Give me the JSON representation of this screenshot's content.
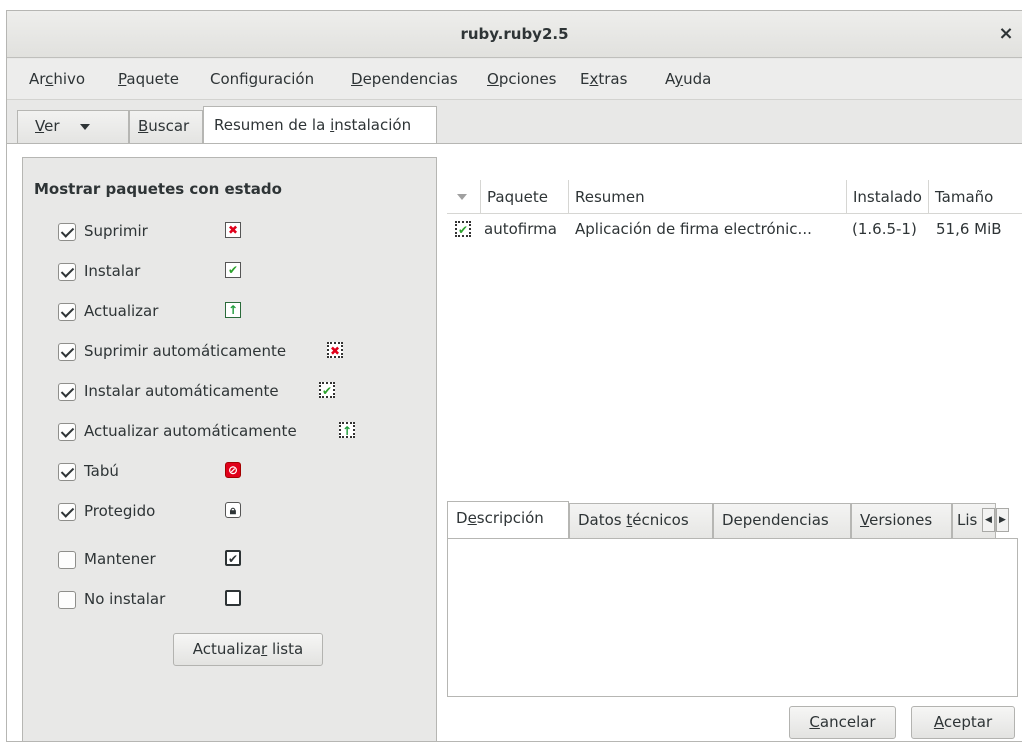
{
  "window": {
    "title": "ruby.ruby2.5",
    "close_glyph": "×"
  },
  "menubar": {
    "items": [
      {
        "pre": "Ar",
        "u": "c",
        "post": "hivo"
      },
      {
        "pre": "",
        "u": "P",
        "post": "aquete"
      },
      {
        "pre": "Confi",
        "u": "g",
        "post": "uración"
      },
      {
        "pre": "",
        "u": "D",
        "post": "ependencias"
      },
      {
        "pre": "",
        "u": "O",
        "post": "pciones"
      },
      {
        "pre": "E",
        "u": "x",
        "post": "tras"
      },
      {
        "pre": "A",
        "u": "y",
        "post": "uda"
      }
    ]
  },
  "toptabs": {
    "view": {
      "u": "V",
      "post": "er"
    },
    "search": {
      "u": "B",
      "post": "uscar"
    },
    "summary": {
      "pre": "Resumen de la ",
      "u": "i",
      "post": "nstalación"
    }
  },
  "filter": {
    "heading": "Mostrar paquetes con estado",
    "rows": [
      {
        "label": "Suprimir",
        "checked": true,
        "icon": "delete-status-icon"
      },
      {
        "label": "Instalar",
        "checked": true,
        "icon": "install-status-icon"
      },
      {
        "label": "Actualizar",
        "checked": true,
        "icon": "update-status-icon"
      },
      {
        "label": "Suprimir automáticamente",
        "checked": true,
        "icon": "autodelete-status-icon"
      },
      {
        "label": "Instalar automáticamente",
        "checked": true,
        "icon": "autoinstall-status-icon"
      },
      {
        "label": "Actualizar automáticamente",
        "checked": true,
        "icon": "autoupdate-status-icon"
      },
      {
        "label": "Tabú",
        "checked": true,
        "icon": "taboo-status-icon"
      },
      {
        "label": "Protegido",
        "checked": true,
        "icon": "lock-status-icon"
      },
      {
        "label": "Mantener",
        "checked": false,
        "icon": "keep-status-icon"
      },
      {
        "label": "No instalar",
        "checked": false,
        "icon": "noinstall-status-icon"
      }
    ],
    "refresh": {
      "pre": "Actualiza",
      "u": "r",
      "post": " lista"
    }
  },
  "table": {
    "columns": [
      "Paquete",
      "Resumen",
      "Instalado",
      "Tamaño"
    ],
    "rows": [
      {
        "package": "autofirma",
        "summary": "Aplicación de firma electrónic...",
        "installed": "(1.6.5-1)",
        "size": "51,6 MiB"
      }
    ]
  },
  "detail_tabs": {
    "description": {
      "pre": "D",
      "u": "e",
      "post": "scripción"
    },
    "technical": {
      "pre": "Datos ",
      "u": "t",
      "post": "écnicos"
    },
    "dependencies": {
      "label": "Dependencias"
    },
    "versions": {
      "pre": "",
      "u": "V",
      "post": "ersiones"
    },
    "list": {
      "label": "Lis"
    }
  },
  "buttons": {
    "cancel": {
      "pre": "",
      "u": "C",
      "post": "ancelar"
    },
    "accept": {
      "pre": "",
      "u": "A",
      "post": "ceptar"
    }
  }
}
